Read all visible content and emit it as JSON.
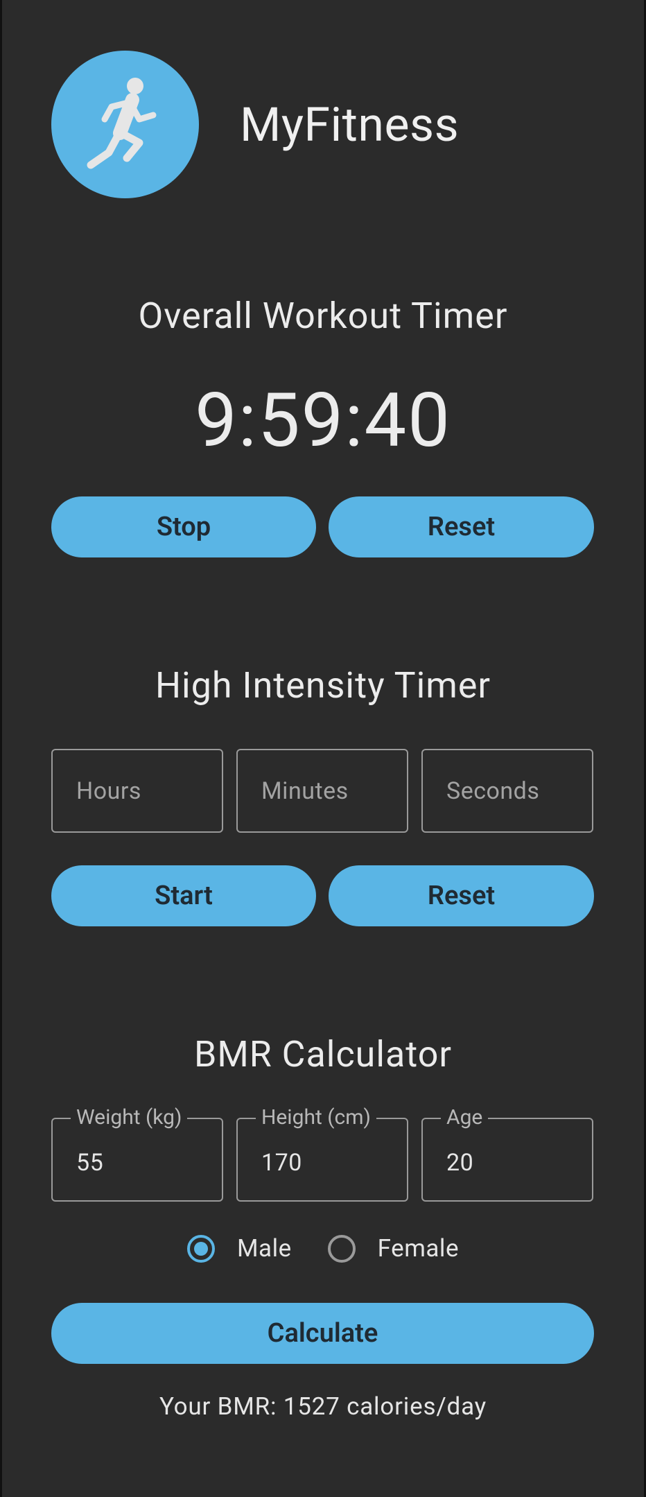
{
  "app": {
    "title": "MyFitness",
    "logo_icon": "running-person-icon",
    "accent_color": "#5ab5e5",
    "background_color": "#2b2b2b"
  },
  "workout_timer": {
    "title": "Overall Workout Timer",
    "display": "9:59:40",
    "stop_label": "Stop",
    "reset_label": "Reset"
  },
  "hiit_timer": {
    "title": "High Intensity Timer",
    "hours_placeholder": "Hours",
    "minutes_placeholder": "Minutes",
    "seconds_placeholder": "Seconds",
    "start_label": "Start",
    "reset_label": "Reset"
  },
  "bmr": {
    "title": "BMR Calculator",
    "weight_label": "Weight (kg)",
    "weight_value": "55",
    "height_label": "Height (cm)",
    "height_value": "170",
    "age_label": "Age",
    "age_value": "20",
    "male_label": "Male",
    "female_label": "Female",
    "selected_sex": "Male",
    "calculate_label": "Calculate",
    "result_text": "Your BMR: 1527 calories/day"
  }
}
